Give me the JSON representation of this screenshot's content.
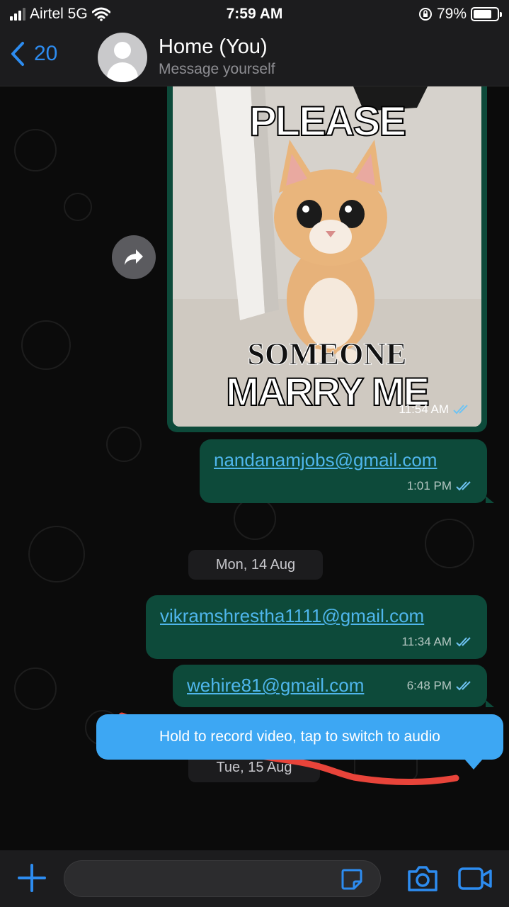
{
  "status_bar": {
    "carrier": "Airtel 5G",
    "time": "7:59 AM",
    "battery": "79%",
    "battery_level": 0.79
  },
  "header": {
    "back_count": "20",
    "title": "Home (You)",
    "subtitle": "Message yourself"
  },
  "messages": [
    {
      "type": "image",
      "image_text_top": "PLEASE",
      "image_text_middle": "SOMEONE",
      "image_text_bottom": "MARRY ME",
      "time": "11:54 AM"
    },
    {
      "type": "text",
      "text": "nandanamjobs@gmail.com",
      "time": "1:01 PM"
    },
    {
      "type": "date",
      "text": "Mon, 14 Aug"
    },
    {
      "type": "text",
      "text": "vikramshrestha1111@gmail.com",
      "time": "11:34 AM"
    },
    {
      "type": "text",
      "text": "wehire81@gmail.com",
      "time": "6:48 PM"
    },
    {
      "type": "date",
      "text": "Tue, 15 Aug"
    }
  ],
  "tooltip": "Hold to record video, tap to switch to audio",
  "icons": {
    "back": "chevron-left-icon",
    "forward": "forward-arrow-icon",
    "read_receipt": "double-check-icon",
    "plus": "plus-icon",
    "sticker": "sticker-icon",
    "camera": "camera-icon",
    "video": "video-camera-icon"
  },
  "colors": {
    "accent": "#2d8cf0",
    "bubble": "#0d4a3a",
    "link": "#4fb6ec",
    "tooltip": "#3da7f3",
    "scribble": "#e8443a"
  }
}
